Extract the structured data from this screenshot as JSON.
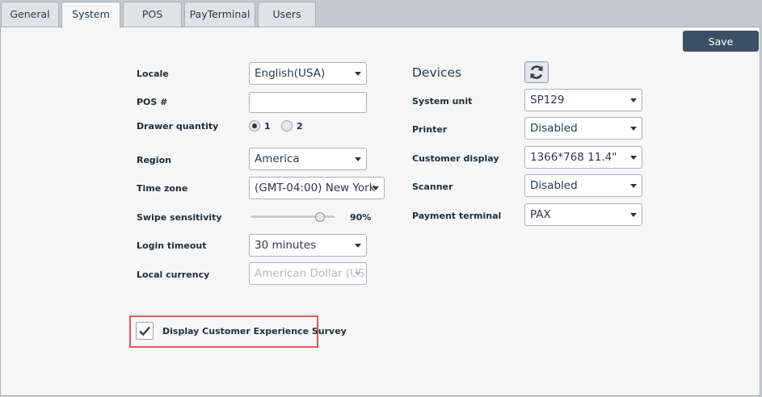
{
  "tabs": [
    {
      "label": "General",
      "active": false
    },
    {
      "label": "System",
      "active": true
    },
    {
      "label": "POS",
      "active": false
    },
    {
      "label": "PayTerminal",
      "active": false
    },
    {
      "label": "Users",
      "active": false
    }
  ],
  "save_label": "Save",
  "system": {
    "locale": {
      "label": "Locale",
      "value": "English(USA)"
    },
    "pos_number": {
      "label": "POS #",
      "value": ""
    },
    "drawer_quantity": {
      "label": "Drawer quantity",
      "options": [
        "1",
        "2"
      ],
      "selected": "1"
    },
    "region": {
      "label": "Region",
      "value": "America"
    },
    "time_zone": {
      "label": "Time zone",
      "value": "(GMT-04:00) New York"
    },
    "swipe_sensitivity": {
      "label": "Swipe sensitivity",
      "value_text": "90%",
      "value": 0.9
    },
    "login_timeout": {
      "label": "Login timeout",
      "value": "30 minutes"
    },
    "local_currency": {
      "label": "Local currency",
      "value": "American Dollar (USD)",
      "disabled": true
    }
  },
  "devices": {
    "title": "Devices",
    "refresh_icon": "refresh-icon",
    "system_unit": {
      "label": "System unit",
      "value": "SP129"
    },
    "printer": {
      "label": "Printer",
      "value": "Disabled"
    },
    "customer_display": {
      "label": "Customer display",
      "value": "1366*768 11.4\""
    },
    "scanner": {
      "label": "Scanner",
      "value": "Disabled"
    },
    "payment_terminal": {
      "label": "Payment terminal",
      "value": "PAX"
    }
  },
  "survey": {
    "label": "Display Customer Experience Survey",
    "checked": true
  },
  "colors": {
    "save_button": "#3b5068",
    "highlight": "#e05a5a",
    "panel": "#f6f6f6"
  }
}
